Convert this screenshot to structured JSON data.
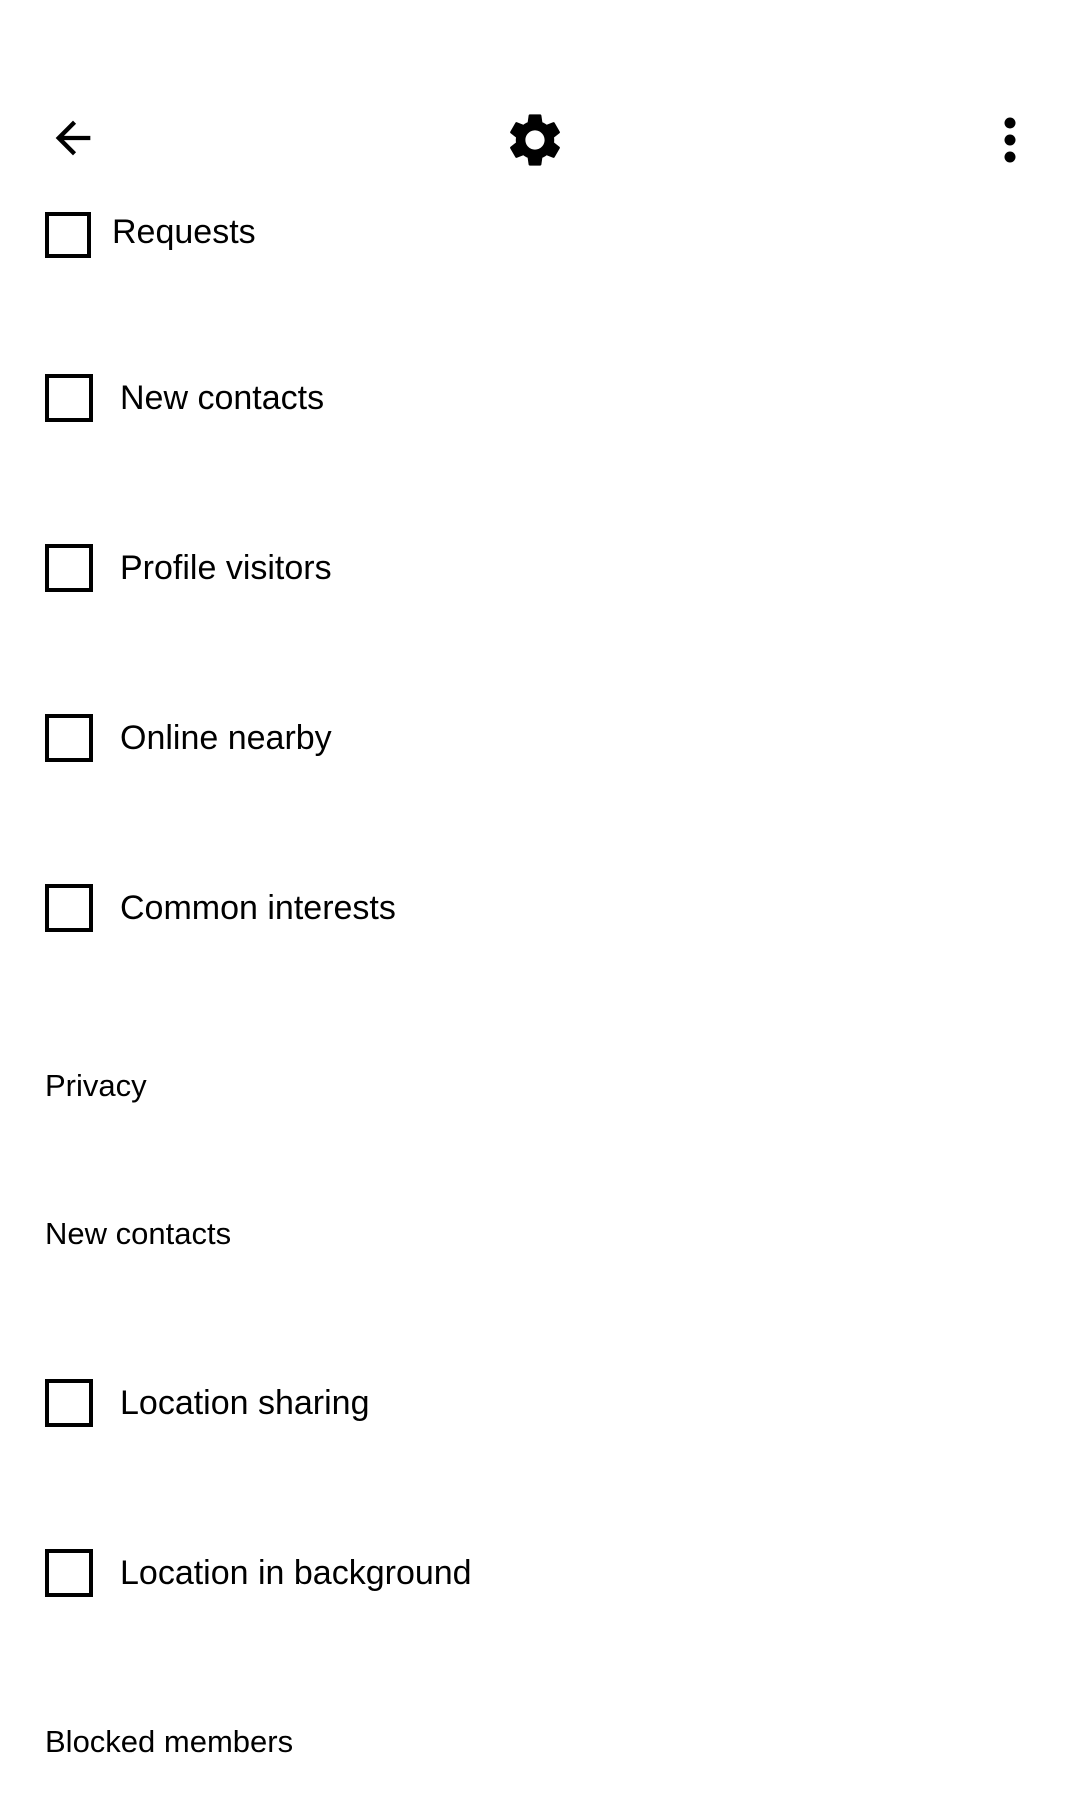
{
  "toolbar": {
    "back_icon": "arrow-left-icon",
    "settings_icon": "gear-icon",
    "more_icon": "more-vert-icon"
  },
  "notifications": [
    {
      "label": "Requests",
      "checked": false
    },
    {
      "label": "New contacts",
      "checked": false
    },
    {
      "label": "Profile visitors",
      "checked": false
    },
    {
      "label": "Online nearby",
      "checked": false
    },
    {
      "label": "Common interests",
      "checked": false
    }
  ],
  "privacy": {
    "title": "Privacy",
    "new_contacts_label": "New contacts",
    "options": [
      {
        "label": "Location sharing",
        "checked": false
      },
      {
        "label": "Location in background",
        "checked": false
      }
    ],
    "blocked_members_label": "Blocked members"
  }
}
